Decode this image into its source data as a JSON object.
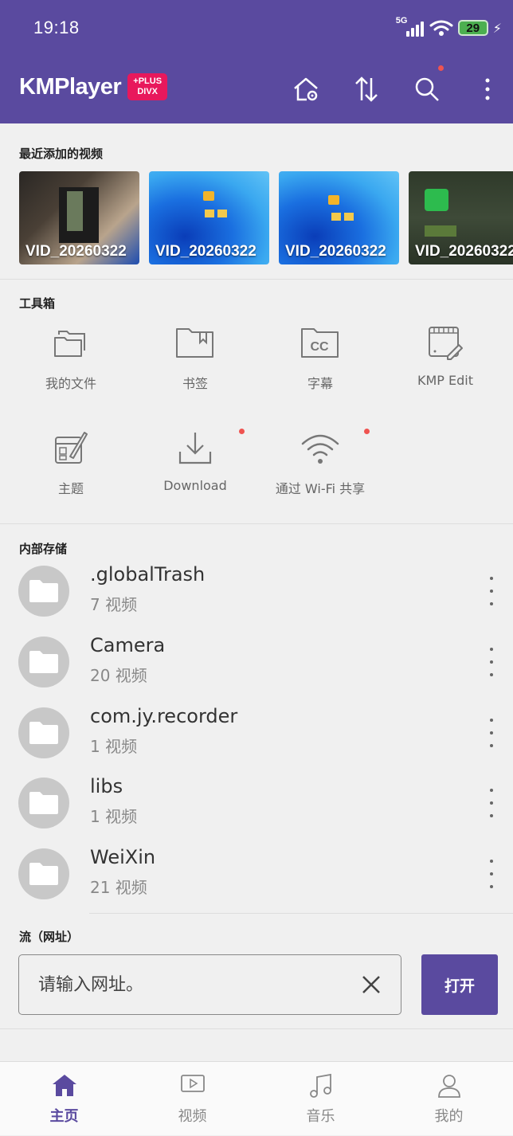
{
  "status_bar": {
    "time": "19:18",
    "network": "5G",
    "battery": "29"
  },
  "app": {
    "logo_text": "KMPlayer",
    "badge_line1": "+PLUS",
    "badge_line2": "DIVX"
  },
  "toolbar": {
    "icons": [
      "home-settings-icon",
      "sort-icon",
      "search-icon",
      "more-vert-icon"
    ]
  },
  "recent": {
    "title": "最近添加的视频",
    "videos": [
      {
        "caption": "VID_20260322"
      },
      {
        "caption": "VID_20260322"
      },
      {
        "caption": "VID_20260322"
      },
      {
        "caption": "VID_20260322"
      }
    ]
  },
  "toolbox": {
    "title": "工具箱",
    "items": [
      {
        "label": "我的文件",
        "icon": "folders-icon"
      },
      {
        "label": "书签",
        "icon": "bookmark-folder-icon"
      },
      {
        "label": "字幕",
        "icon": "subtitles-cc-icon"
      },
      {
        "label": "KMP Edit",
        "icon": "video-edit-icon"
      },
      {
        "label": "主题",
        "icon": "theme-palette-icon"
      },
      {
        "label": "Download",
        "icon": "download-icon"
      },
      {
        "label": "通过 Wi-Fi 共享",
        "icon": "wifi-icon"
      }
    ]
  },
  "storage": {
    "title": "内部存储",
    "folders": [
      {
        "name": ".globalTrash",
        "count": "7 视频"
      },
      {
        "name": "Camera",
        "count": "20 视频"
      },
      {
        "name": "com.jy.recorder",
        "count": "1 视频"
      },
      {
        "name": "libs",
        "count": "1 视频"
      },
      {
        "name": "WeiXin",
        "count": "21 视频"
      }
    ]
  },
  "stream": {
    "title": "流（网址）",
    "placeholder": "请输入网址。",
    "open_label": "打开"
  },
  "bottom_nav": {
    "items": [
      {
        "label": "主页",
        "icon": "home-icon",
        "active": true
      },
      {
        "label": "视频",
        "icon": "video-icon",
        "active": false
      },
      {
        "label": "音乐",
        "icon": "music-icon",
        "active": false
      },
      {
        "label": "我的",
        "icon": "profile-icon",
        "active": false
      }
    ]
  },
  "colors": {
    "primary": "#5a4a9f",
    "badge": "#e8185c",
    "notification_dot": "#ef5350"
  }
}
